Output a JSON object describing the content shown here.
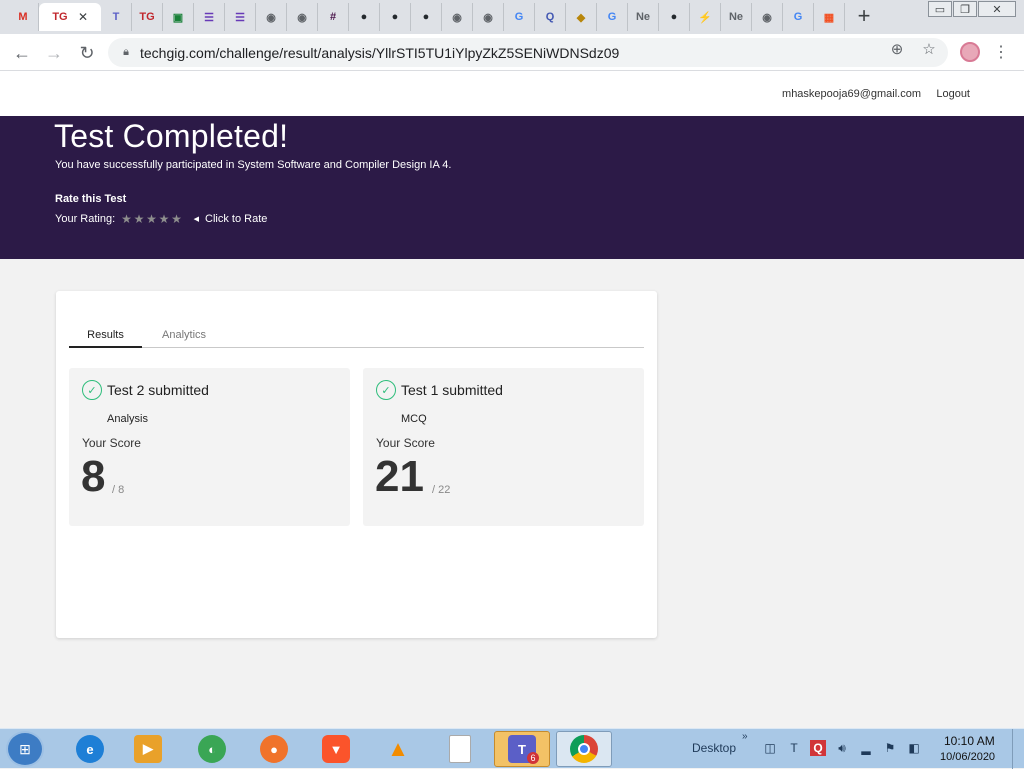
{
  "browser": {
    "tabs": [
      {
        "icon": "gmail-icon",
        "glyph": "M",
        "color": "#d93025",
        "active": false
      },
      {
        "icon": "techgig-icon",
        "glyph": "TG",
        "color": "#c1272d",
        "active": true
      },
      {
        "icon": "teams-icon",
        "glyph": "T",
        "color": "#5b5fc7",
        "active": false
      },
      {
        "icon": "techgig-icon",
        "glyph": "TG",
        "color": "#c1272d",
        "active": false
      },
      {
        "icon": "classroom-icon",
        "glyph": "▣",
        "color": "#188038",
        "active": false
      },
      {
        "icon": "forms-icon",
        "glyph": "☰",
        "color": "#673ab7",
        "active": false
      },
      {
        "icon": "forms-icon",
        "glyph": "☰",
        "color": "#673ab7",
        "active": false
      },
      {
        "icon": "globe-icon",
        "glyph": "◉",
        "color": "#5f6368",
        "active": false
      },
      {
        "icon": "globe-icon",
        "glyph": "◉",
        "color": "#5f6368",
        "active": false
      },
      {
        "icon": "slack-icon",
        "glyph": "#",
        "color": "#4a154b",
        "active": false
      },
      {
        "icon": "github-icon",
        "glyph": "●",
        "color": "#24292e",
        "active": false
      },
      {
        "icon": "github-icon",
        "glyph": "●",
        "color": "#24292e",
        "active": false
      },
      {
        "icon": "github-icon",
        "glyph": "●",
        "color": "#24292e",
        "active": false
      },
      {
        "icon": "globe-icon",
        "glyph": "◉",
        "color": "#5f6368",
        "active": false
      },
      {
        "icon": "globe-icon",
        "glyph": "◉",
        "color": "#5f6368",
        "active": false
      },
      {
        "icon": "google-icon",
        "glyph": "G",
        "color": "#4285f4",
        "active": false
      },
      {
        "icon": "quizlet-icon",
        "glyph": "Q",
        "color": "#4257b2",
        "active": false
      },
      {
        "icon": "badge-icon",
        "glyph": "◆",
        "color": "#b8860b",
        "active": false
      },
      {
        "icon": "google-icon",
        "glyph": "G",
        "color": "#4285f4",
        "active": false
      },
      {
        "icon": "tab-text-icon",
        "glyph": "Ne",
        "color": "#5f6368",
        "active": false
      },
      {
        "icon": "github-icon",
        "glyph": "●",
        "color": "#24292e",
        "active": false
      },
      {
        "icon": "bolt-icon",
        "glyph": "⚡",
        "color": "#5a3e9a",
        "active": false
      },
      {
        "icon": "tab-text-icon",
        "glyph": "Ne",
        "color": "#5f6368",
        "active": false
      },
      {
        "icon": "globe-icon",
        "glyph": "◉",
        "color": "#5f6368",
        "active": false
      },
      {
        "icon": "google-icon",
        "glyph": "G",
        "color": "#4285f4",
        "active": false
      },
      {
        "icon": "microsoft-icon",
        "glyph": "▦",
        "color": "#f25022",
        "active": false
      }
    ],
    "close_glyph": "✕",
    "new_tab_glyph": "+",
    "url": "techgig.com/challenge/result/analysis/YllrSTI5TU1iYlpyZkZ5SENiWDNSdz09",
    "minimize_glyph": "▭",
    "restore_glyph": "❐",
    "close_window_glyph": "✕"
  },
  "header": {
    "email": "mhaskepooja69@gmail.com",
    "logout": "Logout"
  },
  "banner": {
    "title": "Test Completed!",
    "subtitle": "You have successfully participated in System Software and Compiler Design IA 4.",
    "rate_title": "Rate this Test",
    "rating_label": "Your Rating:",
    "stars": "★★★★★",
    "click_to_rate": "Click to Rate"
  },
  "card": {
    "tabs": [
      "Results",
      "Analytics"
    ],
    "results": [
      {
        "title": "Test 2 submitted",
        "type": "Analysis",
        "score_label": "Your Score",
        "score": "8",
        "total": "/ 8"
      },
      {
        "title": "Test 1 submitted",
        "type": "MCQ",
        "score_label": "Your Score",
        "score": "21",
        "total": "/ 22"
      }
    ]
  },
  "taskbar": {
    "desktop_label": "Desktop",
    "chevron": "»",
    "time": "10:10 AM",
    "date": "10/06/2020",
    "teams_badge": "6"
  }
}
